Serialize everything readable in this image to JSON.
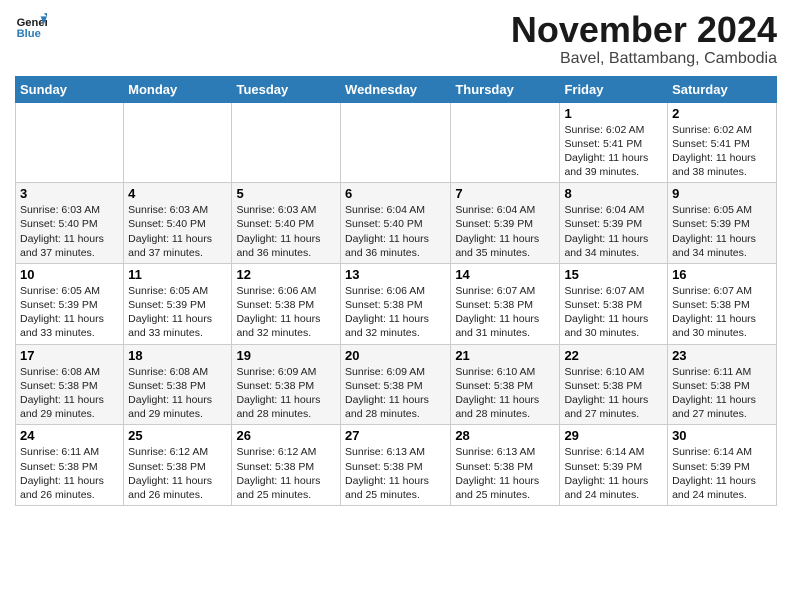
{
  "header": {
    "logo_line1": "General",
    "logo_line2": "Blue",
    "month_title": "November 2024",
    "location": "Bavel, Battambang, Cambodia"
  },
  "days_of_week": [
    "Sunday",
    "Monday",
    "Tuesday",
    "Wednesday",
    "Thursday",
    "Friday",
    "Saturday"
  ],
  "weeks": [
    [
      {
        "day": "",
        "info": ""
      },
      {
        "day": "",
        "info": ""
      },
      {
        "day": "",
        "info": ""
      },
      {
        "day": "",
        "info": ""
      },
      {
        "day": "",
        "info": ""
      },
      {
        "day": "1",
        "info": "Sunrise: 6:02 AM\nSunset: 5:41 PM\nDaylight: 11 hours\nand 39 minutes."
      },
      {
        "day": "2",
        "info": "Sunrise: 6:02 AM\nSunset: 5:41 PM\nDaylight: 11 hours\nand 38 minutes."
      }
    ],
    [
      {
        "day": "3",
        "info": "Sunrise: 6:03 AM\nSunset: 5:40 PM\nDaylight: 11 hours\nand 37 minutes."
      },
      {
        "day": "4",
        "info": "Sunrise: 6:03 AM\nSunset: 5:40 PM\nDaylight: 11 hours\nand 37 minutes."
      },
      {
        "day": "5",
        "info": "Sunrise: 6:03 AM\nSunset: 5:40 PM\nDaylight: 11 hours\nand 36 minutes."
      },
      {
        "day": "6",
        "info": "Sunrise: 6:04 AM\nSunset: 5:40 PM\nDaylight: 11 hours\nand 36 minutes."
      },
      {
        "day": "7",
        "info": "Sunrise: 6:04 AM\nSunset: 5:39 PM\nDaylight: 11 hours\nand 35 minutes."
      },
      {
        "day": "8",
        "info": "Sunrise: 6:04 AM\nSunset: 5:39 PM\nDaylight: 11 hours\nand 34 minutes."
      },
      {
        "day": "9",
        "info": "Sunrise: 6:05 AM\nSunset: 5:39 PM\nDaylight: 11 hours\nand 34 minutes."
      }
    ],
    [
      {
        "day": "10",
        "info": "Sunrise: 6:05 AM\nSunset: 5:39 PM\nDaylight: 11 hours\nand 33 minutes."
      },
      {
        "day": "11",
        "info": "Sunrise: 6:05 AM\nSunset: 5:39 PM\nDaylight: 11 hours\nand 33 minutes."
      },
      {
        "day": "12",
        "info": "Sunrise: 6:06 AM\nSunset: 5:38 PM\nDaylight: 11 hours\nand 32 minutes."
      },
      {
        "day": "13",
        "info": "Sunrise: 6:06 AM\nSunset: 5:38 PM\nDaylight: 11 hours\nand 32 minutes."
      },
      {
        "day": "14",
        "info": "Sunrise: 6:07 AM\nSunset: 5:38 PM\nDaylight: 11 hours\nand 31 minutes."
      },
      {
        "day": "15",
        "info": "Sunrise: 6:07 AM\nSunset: 5:38 PM\nDaylight: 11 hours\nand 30 minutes."
      },
      {
        "day": "16",
        "info": "Sunrise: 6:07 AM\nSunset: 5:38 PM\nDaylight: 11 hours\nand 30 minutes."
      }
    ],
    [
      {
        "day": "17",
        "info": "Sunrise: 6:08 AM\nSunset: 5:38 PM\nDaylight: 11 hours\nand 29 minutes."
      },
      {
        "day": "18",
        "info": "Sunrise: 6:08 AM\nSunset: 5:38 PM\nDaylight: 11 hours\nand 29 minutes."
      },
      {
        "day": "19",
        "info": "Sunrise: 6:09 AM\nSunset: 5:38 PM\nDaylight: 11 hours\nand 28 minutes."
      },
      {
        "day": "20",
        "info": "Sunrise: 6:09 AM\nSunset: 5:38 PM\nDaylight: 11 hours\nand 28 minutes."
      },
      {
        "day": "21",
        "info": "Sunrise: 6:10 AM\nSunset: 5:38 PM\nDaylight: 11 hours\nand 28 minutes."
      },
      {
        "day": "22",
        "info": "Sunrise: 6:10 AM\nSunset: 5:38 PM\nDaylight: 11 hours\nand 27 minutes."
      },
      {
        "day": "23",
        "info": "Sunrise: 6:11 AM\nSunset: 5:38 PM\nDaylight: 11 hours\nand 27 minutes."
      }
    ],
    [
      {
        "day": "24",
        "info": "Sunrise: 6:11 AM\nSunset: 5:38 PM\nDaylight: 11 hours\nand 26 minutes."
      },
      {
        "day": "25",
        "info": "Sunrise: 6:12 AM\nSunset: 5:38 PM\nDaylight: 11 hours\nand 26 minutes."
      },
      {
        "day": "26",
        "info": "Sunrise: 6:12 AM\nSunset: 5:38 PM\nDaylight: 11 hours\nand 25 minutes."
      },
      {
        "day": "27",
        "info": "Sunrise: 6:13 AM\nSunset: 5:38 PM\nDaylight: 11 hours\nand 25 minutes."
      },
      {
        "day": "28",
        "info": "Sunrise: 6:13 AM\nSunset: 5:38 PM\nDaylight: 11 hours\nand 25 minutes."
      },
      {
        "day": "29",
        "info": "Sunrise: 6:14 AM\nSunset: 5:39 PM\nDaylight: 11 hours\nand 24 minutes."
      },
      {
        "day": "30",
        "info": "Sunrise: 6:14 AM\nSunset: 5:39 PM\nDaylight: 11 hours\nand 24 minutes."
      }
    ]
  ]
}
